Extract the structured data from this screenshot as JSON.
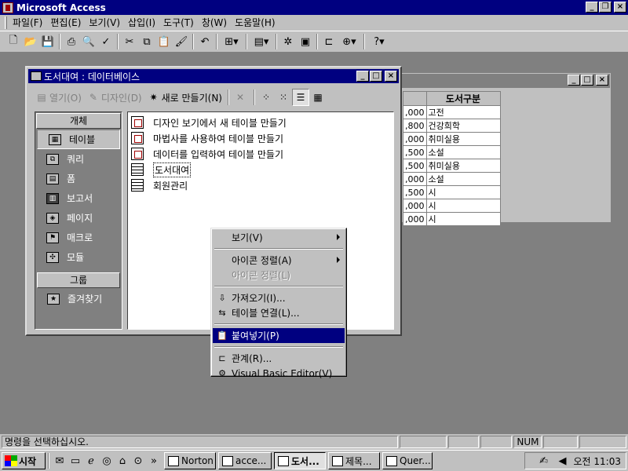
{
  "app": {
    "title": "Microsoft Access"
  },
  "menu": [
    "파일(F)",
    "편집(E)",
    "보기(V)",
    "삽입(I)",
    "도구(T)",
    "창(W)",
    "도움말(H)"
  ],
  "db_window": {
    "title": "도서대여 : 데이터베이스",
    "toolbar": {
      "open": "열기(O)",
      "design": "디자인(D)",
      "new": "새로 만들기(N)"
    },
    "objects_header": "개체",
    "objects": [
      "테이블",
      "쿼리",
      "폼",
      "보고서",
      "페이지",
      "매크로",
      "모듈"
    ],
    "groups_header": "그룹",
    "groups": [
      "즐겨찾기"
    ],
    "list": [
      "디자인 보기에서 새 테이블 만들기",
      "마법사를 사용하여 테이블 만들기",
      "데이터를 입력하여 테이블 만들기",
      "도서대여",
      "회원관리"
    ]
  },
  "bg_table": {
    "headers": [
      "",
      "도서구분"
    ],
    "rows": [
      [
        ",000",
        "고전"
      ],
      [
        ",800",
        "건강희학"
      ],
      [
        ",000",
        "취미실용"
      ],
      [
        ",500",
        "소설"
      ],
      [
        ",500",
        "취미실용"
      ],
      [
        ",000",
        "소설"
      ],
      [
        ",500",
        "시"
      ],
      [
        ",000",
        "시"
      ],
      [
        ",000",
        "시"
      ]
    ]
  },
  "context_menu": [
    {
      "label": "보기(V)",
      "submenu": true
    },
    {
      "sep": true
    },
    {
      "label": "아이콘 정렬(A)",
      "submenu": true
    },
    {
      "label": "아이콘 정렬(L)",
      "disabled": true
    },
    {
      "sep": true
    },
    {
      "label": "가져오기(I)...",
      "icon": "import-icon"
    },
    {
      "label": "테이블 연결(L)...",
      "icon": "link-table-icon"
    },
    {
      "sep": true
    },
    {
      "label": "붙여넣기(P)",
      "icon": "paste-icon",
      "highlighted": true
    },
    {
      "sep": true
    },
    {
      "label": "관계(R)...",
      "icon": "relationships-icon"
    },
    {
      "label": "Visual Basic Editor(V)",
      "icon": "vba-icon"
    }
  ],
  "status": {
    "message": "명령을 선택하십시오.",
    "num": "NUM"
  },
  "taskbar": {
    "start": "시작",
    "tasks": [
      "Norton A...",
      "acce...",
      "도서...",
      "제목...",
      "Quer..."
    ],
    "active_index": 2,
    "clock": "오전 11:03"
  }
}
